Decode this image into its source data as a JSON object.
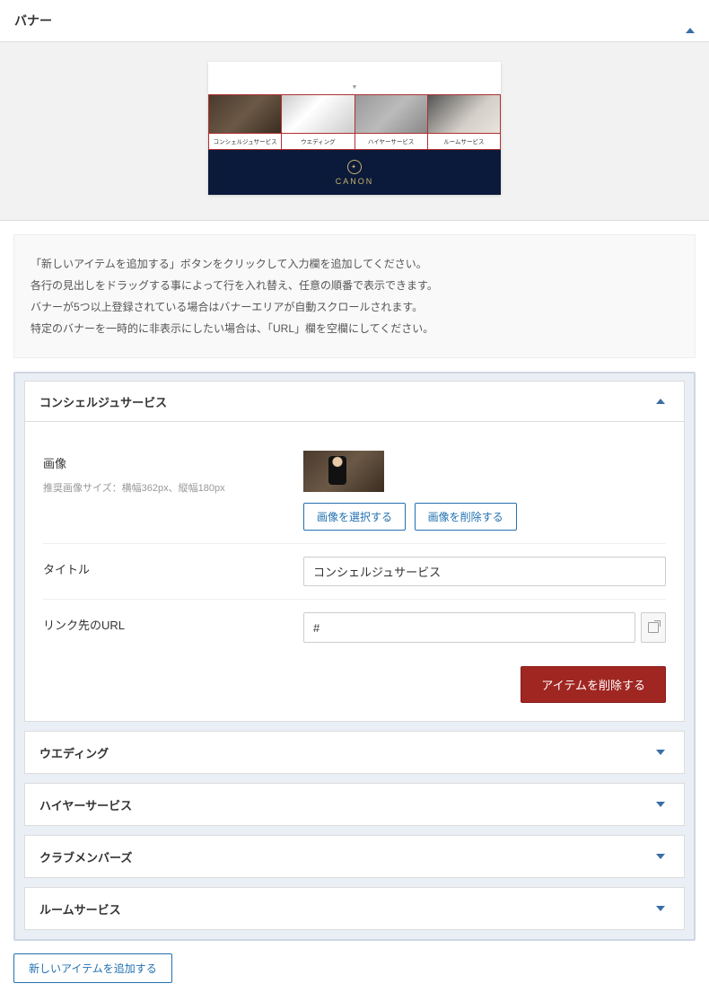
{
  "header": {
    "title": "バナー"
  },
  "preview": {
    "cells": [
      "コンシェルジュサービス",
      "ウエディング",
      "ハイヤーサービス",
      "ルームサービス"
    ],
    "footer_brand": "CANON"
  },
  "instructions": [
    "「新しいアイテムを追加する」ボタンをクリックして入力欄を追加してください。",
    "各行の見出しをドラッグする事によって行を入れ替え、任意の順番で表示できます。",
    "バナーが5つ以上登録されている場合はバナーエリアが自動スクロールされます。",
    "特定のバナーを一時的に非表示にしたい場合は、「URL」欄を空欄にしてください。"
  ],
  "expanded": {
    "title": "コンシェルジュサービス",
    "image_label": "画像",
    "image_hint": "推奨画像サイズ：横幅362px、縦幅180px",
    "select_image_btn": "画像を選択する",
    "delete_image_btn": "画像を削除する",
    "title_field_label": "タイトル",
    "title_value": "コンシェルジュサービス",
    "url_field_label": "リンク先のURL",
    "url_value": "#",
    "delete_item_btn": "アイテムを削除する"
  },
  "collapsed_items": [
    "ウエディング",
    "ハイヤーサービス",
    "クラブメンバーズ",
    "ルームサービス"
  ],
  "add_button": "新しいアイテムを追加する"
}
